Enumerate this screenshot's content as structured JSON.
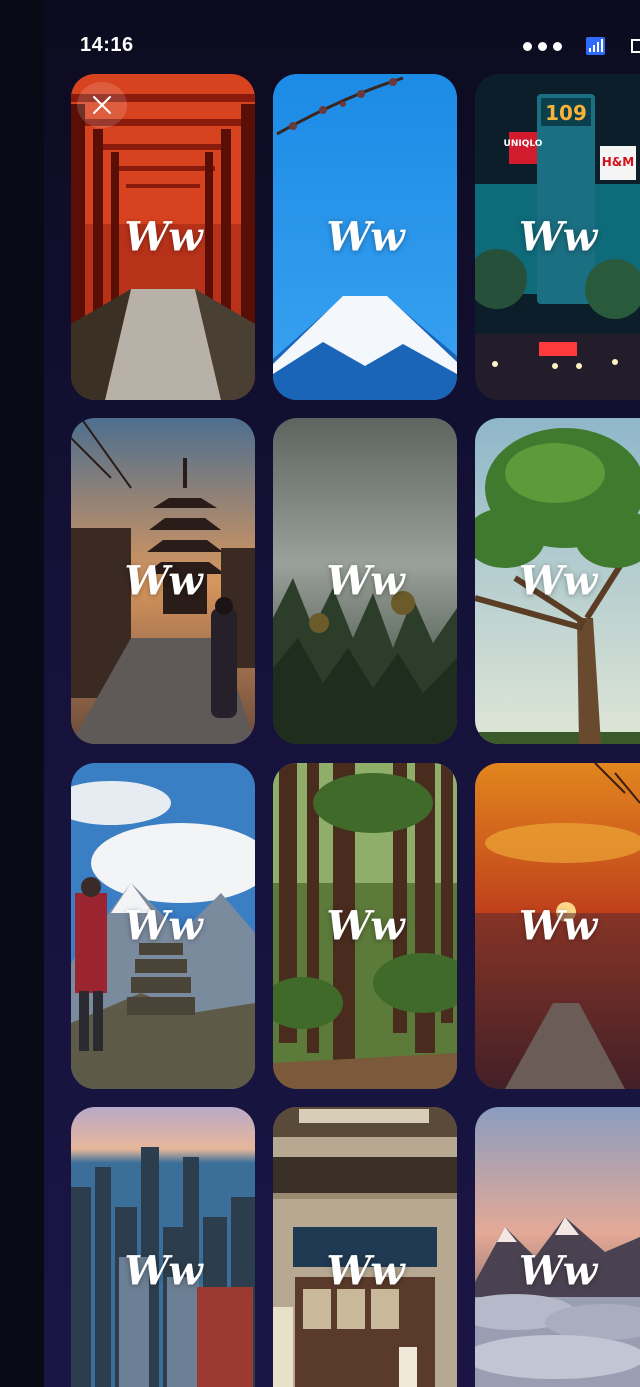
{
  "status_bar": {
    "time": "14:16"
  },
  "close_button": {
    "icon": "close-icon"
  },
  "wallpapers": [
    {
      "watermark": "Ww",
      "subject": "torii-gates-path"
    },
    {
      "watermark": "Ww",
      "subject": "mount-fuji-blossom"
    },
    {
      "watermark": "Ww",
      "subject": "shibuya-109-night",
      "signs": [
        "109",
        "UNIQLO",
        "H&M"
      ]
    },
    {
      "watermark": "Ww",
      "subject": "pagoda-street-kimono"
    },
    {
      "watermark": "Ww",
      "subject": "misty-pine-forest"
    },
    {
      "watermark": "Ww",
      "subject": "lone-tree-sky"
    },
    {
      "watermark": "Ww",
      "subject": "hiker-mountain-cairn"
    },
    {
      "watermark": "Ww",
      "subject": "redwood-forest"
    },
    {
      "watermark": "Ww",
      "subject": "sunset-pier"
    },
    {
      "watermark": "Ww",
      "subject": "chicago-skyline"
    },
    {
      "watermark": "Ww",
      "subject": "japanese-storefront"
    },
    {
      "watermark": "Ww",
      "subject": "mountain-above-clouds"
    }
  ],
  "colors": {
    "background": "#0a0a16",
    "panel": "#15123a",
    "signal_accent": "#2f6bff"
  }
}
